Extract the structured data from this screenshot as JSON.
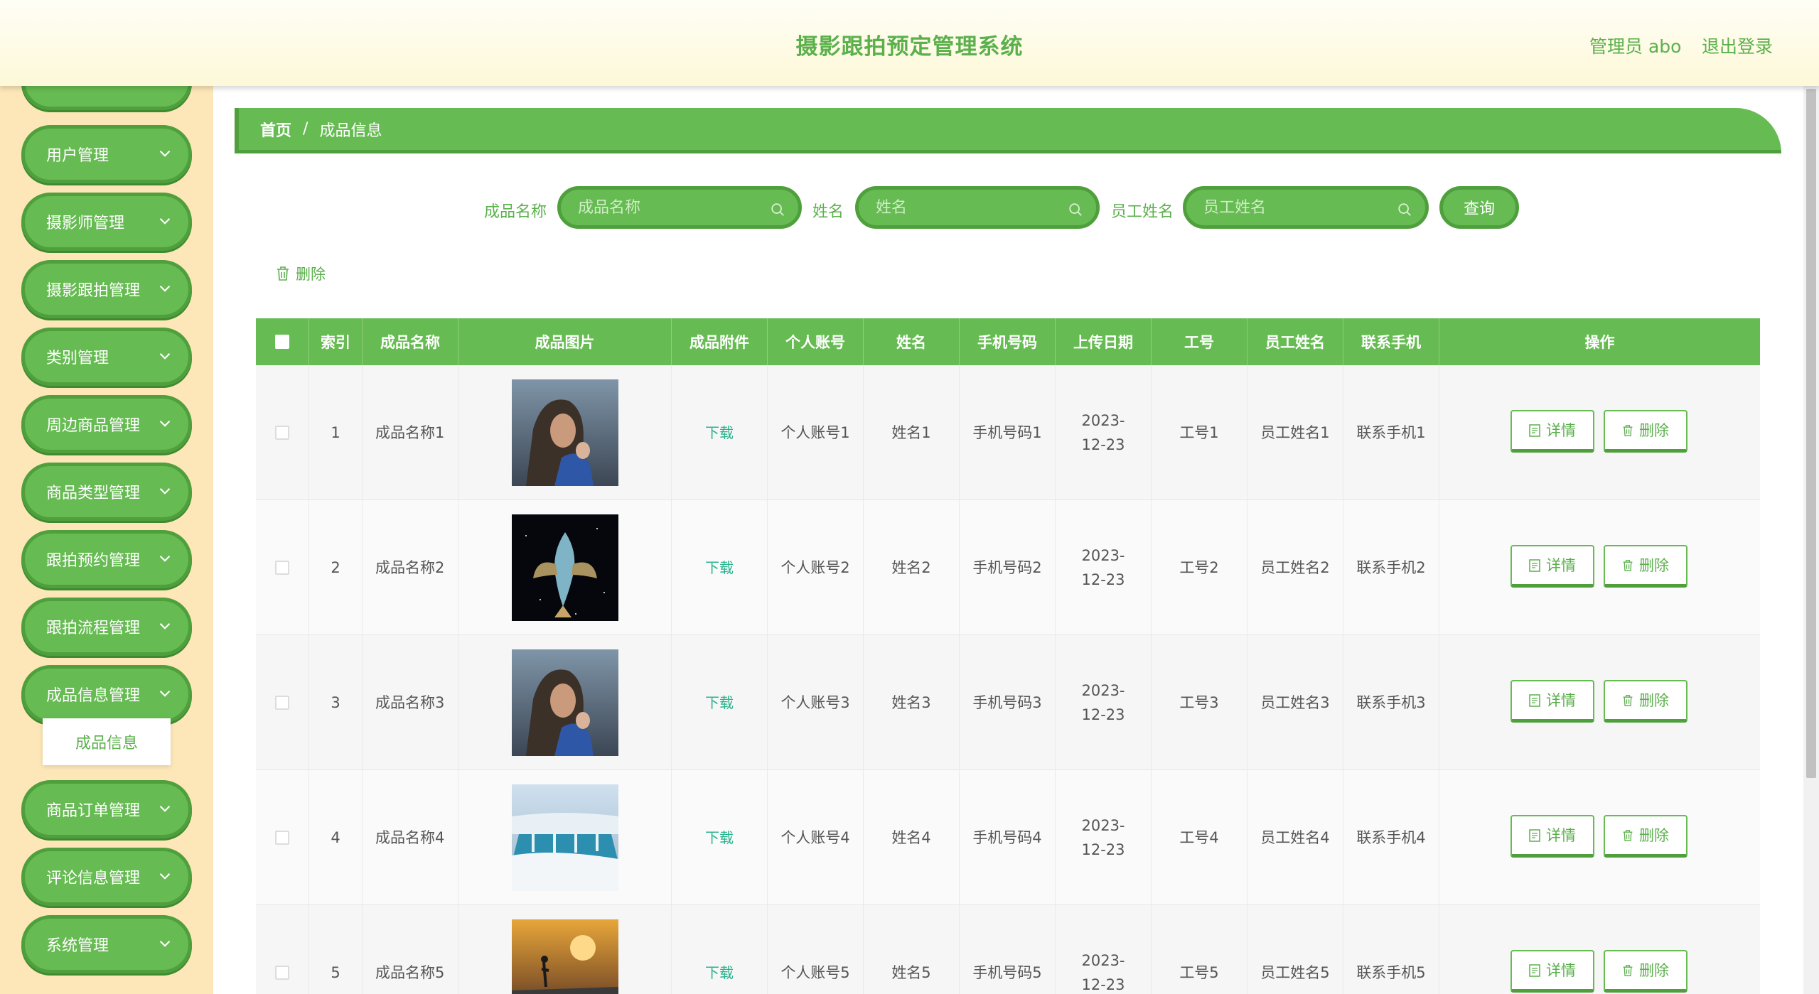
{
  "header": {
    "title": "摄影跟拍预定管理系统",
    "user": "管理员 abo",
    "logout": "退出登录"
  },
  "sidebar": {
    "items": [
      {
        "label": "用户管理"
      },
      {
        "label": "摄影师管理"
      },
      {
        "label": "摄影跟拍管理"
      },
      {
        "label": "类别管理"
      },
      {
        "label": "周边商品管理"
      },
      {
        "label": "商品类型管理"
      },
      {
        "label": "跟拍预约管理"
      },
      {
        "label": "跟拍流程管理"
      },
      {
        "label": "成品信息管理"
      },
      {
        "label": "商品订单管理"
      },
      {
        "label": "评论信息管理"
      },
      {
        "label": "系统管理"
      }
    ],
    "submenu": "成品信息"
  },
  "breadcrumb": {
    "home": "首页",
    "separator": "/",
    "current": "成品信息"
  },
  "search": {
    "field1_label": "成品名称",
    "field1_placeholder": "成品名称",
    "field2_label": "姓名",
    "field2_placeholder": "姓名",
    "field3_label": "员工姓名",
    "field3_placeholder": "员工姓名",
    "query": "查询"
  },
  "toolbar": {
    "delete": "删除"
  },
  "table": {
    "headers": [
      "索引",
      "成品名称",
      "成品图片",
      "成品附件",
      "个人账号",
      "姓名",
      "手机号码",
      "上传日期",
      "工号",
      "员工姓名",
      "联系手机",
      "操作"
    ],
    "rows": [
      {
        "index": "1",
        "name": "成品名称1",
        "file": "下载",
        "account": "个人账号1",
        "person": "姓名1",
        "phone": "手机号码1",
        "date": "2023-12-23",
        "empno": "工号1",
        "empname": "员工姓名1",
        "contact": "联系手机1",
        "image": "portrait-mother-child"
      },
      {
        "index": "2",
        "name": "成品名称2",
        "file": "下载",
        "account": "个人账号2",
        "person": "姓名2",
        "phone": "手机号码2",
        "date": "2023-12-23",
        "empno": "工号2",
        "empname": "员工姓名2",
        "contact": "联系手机2",
        "image": "fish-space"
      },
      {
        "index": "3",
        "name": "成品名称3",
        "file": "下载",
        "account": "个人账号3",
        "person": "姓名3",
        "phone": "手机号码3",
        "date": "2023-12-23",
        "empno": "工号3",
        "empname": "员工姓名3",
        "contact": "联系手机3",
        "image": "portrait-mother-child"
      },
      {
        "index": "4",
        "name": "成品名称4",
        "file": "下载",
        "account": "个人账号4",
        "person": "姓名4",
        "phone": "手机号码4",
        "date": "2023-12-23",
        "empno": "工号4",
        "empname": "员工姓名4",
        "contact": "联系手机4",
        "image": "waterfall-snow"
      },
      {
        "index": "5",
        "name": "成品名称5",
        "file": "下载",
        "account": "个人账号5",
        "person": "姓名5",
        "phone": "手机号码5",
        "date": "2023-12-23",
        "empno": "工号5",
        "empname": "员工姓名5",
        "contact": "联系手机5",
        "image": "sunset-walker"
      }
    ],
    "actions": {
      "detail": "详情",
      "delete": "删除"
    }
  },
  "colors": {
    "primary": "#66bb52",
    "primary_dark": "#4fa03d",
    "sidebar_bg": "#fde7b8",
    "link": "#2bb38e"
  }
}
